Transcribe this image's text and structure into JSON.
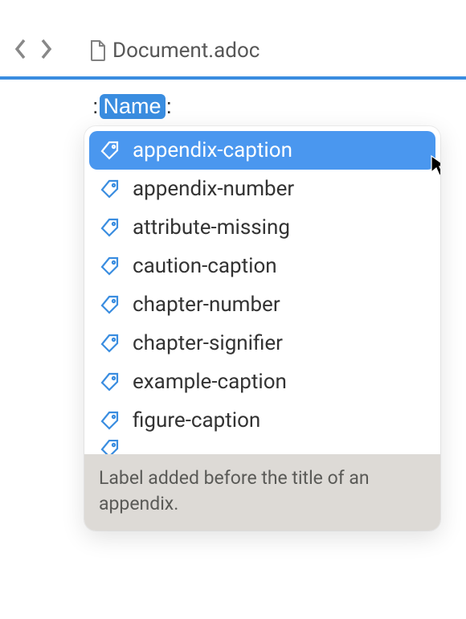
{
  "nav": {
    "file_name": "Document.adoc"
  },
  "editor": {
    "prefix_colon": ":",
    "highlighted_text": "Name",
    "suffix_colon": ":"
  },
  "autocomplete": {
    "items": [
      {
        "label": "appendix-caption",
        "selected": true
      },
      {
        "label": "appendix-number",
        "selected": false
      },
      {
        "label": "attribute-missing",
        "selected": false
      },
      {
        "label": "caution-caption",
        "selected": false
      },
      {
        "label": "chapter-number",
        "selected": false
      },
      {
        "label": "chapter-signifier",
        "selected": false
      },
      {
        "label": "example-caption",
        "selected": false
      },
      {
        "label": "figure-caption",
        "selected": false
      }
    ],
    "description": "Label added before the title of an appendix."
  }
}
